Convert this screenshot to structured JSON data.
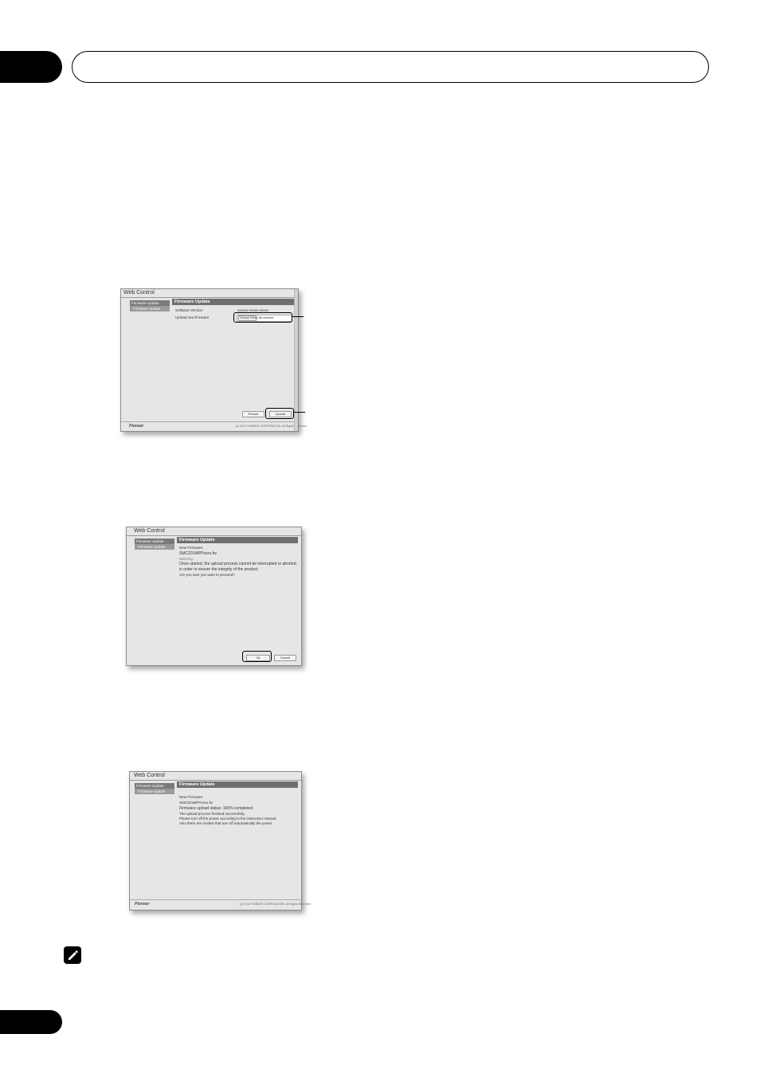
{
  "shot1": {
    "title": "Web Control",
    "sidebar_header": "Firmware Update",
    "sidebar_item": "Firmware Update",
    "main_header": "Firmware Update",
    "software_version_label": "Software Version:",
    "software_version_value": "xxxxxx-xxxxx-xxxxx",
    "upload_label": "Upload new firmware",
    "choose_file_label": "Choose File",
    "no_file_text": "no file selected",
    "restart_button": "Restart",
    "upload_button": "Upload",
    "logo": "Pioneer",
    "copyright": "(c) 2011 PIONEER CORPORATION. All Rights Reserved."
  },
  "shot2": {
    "title": "Web Control",
    "sidebar_header": "Firmware Update",
    "sidebar_item": "Firmware Update",
    "main_header": "Firmware Update",
    "new_firmware_label": "New Firmware:",
    "new_firmware_value": "SMC201MPPxxxx.fw",
    "warning_label": "Warning:",
    "warning_line1": "Once started, the upload process cannot be interrupted or aborted,",
    "warning_line2": "in order to ensure the integrity of the product.",
    "confirm_question": "Are you sure you want to proceed?",
    "ok_button": "Ok",
    "cancel_button": "Cancel"
  },
  "shot3": {
    "title": "Web Control",
    "sidebar_header": "Firmware Update",
    "sidebar_item": "Firmware Update",
    "main_header": "Firmware Update",
    "new_firmware_label": "New Firmware:",
    "new_firmware_value": "SMC201MPPxxxx.fw",
    "status_line": "Firmware upload status: 100% completed.",
    "line1": "The upload process finished successfully.",
    "line2": "Please turn off the power according to the instruction manual.",
    "line3": "Also there are models that turn off automatically the power.",
    "logo": "Pioneer",
    "copyright": "(c) 2011 PIONEER CORPORATION. All Rights Reserved."
  }
}
